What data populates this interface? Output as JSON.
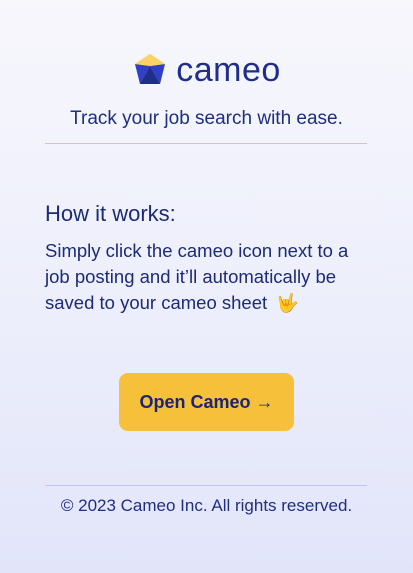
{
  "brand": {
    "name": "cameo",
    "tagline": "Track your job search with ease.",
    "colors": {
      "primary": "#1f2e8a",
      "accent": "#f6c03b",
      "divider": "#f4c46a"
    }
  },
  "how_it_works": {
    "title": "How it works:",
    "body": "Simply click the cameo icon next to a job posting and it’ll automatically be saved to your cameo sheet",
    "emoji": "🤟"
  },
  "open_button": {
    "label": "Open Cameo →"
  },
  "footer": {
    "copyright": "© 2023 Cameo Inc. All rights reserved."
  }
}
